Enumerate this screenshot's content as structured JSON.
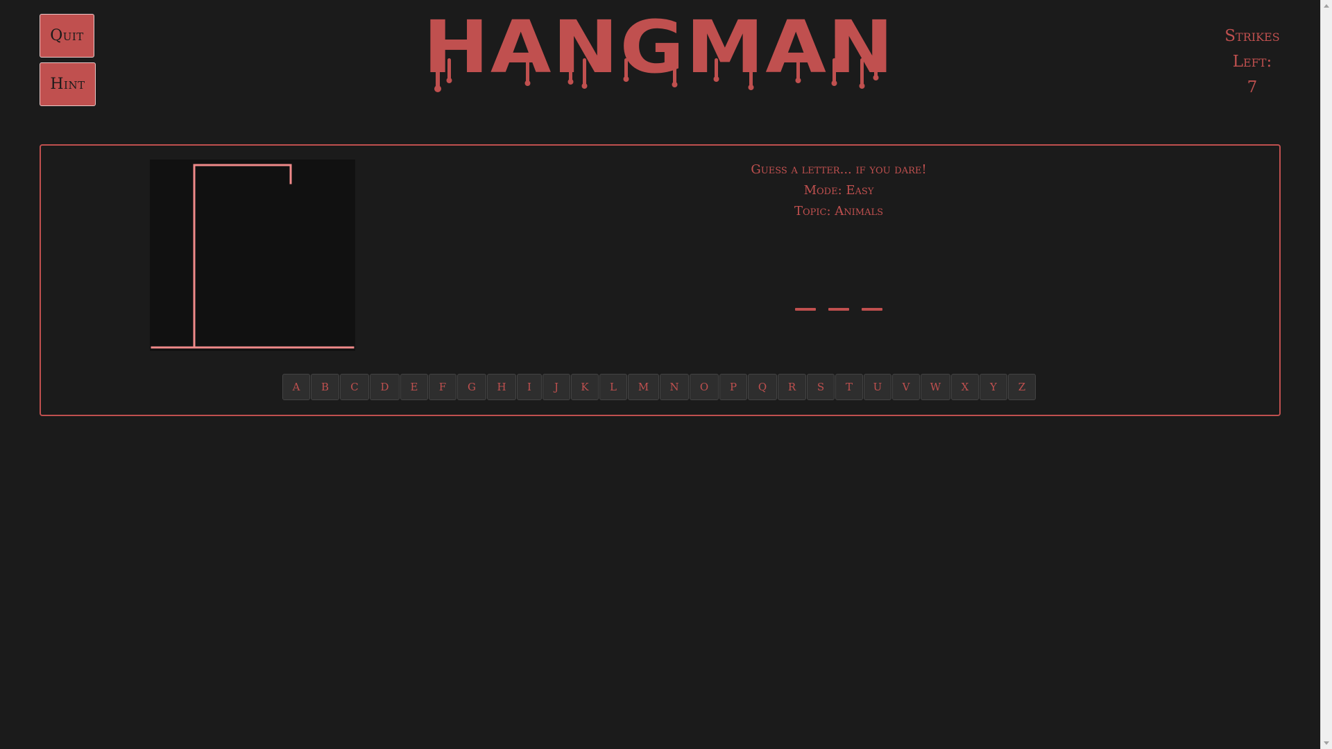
{
  "header": {
    "title": "HANGMAN",
    "quit_label": "Quit",
    "hint_label": "Hint",
    "strikes_label_line1": "Strikes",
    "strikes_label_line2": "Left:",
    "strikes_left": "7"
  },
  "game": {
    "prompt": "Guess a letter... if you dare!",
    "mode_text": "Mode: Easy",
    "topic_text": "Topic: Animals",
    "word_blanks": [
      "",
      "",
      ""
    ],
    "letters": [
      "A",
      "B",
      "C",
      "D",
      "E",
      "F",
      "G",
      "H",
      "I",
      "J",
      "K",
      "L",
      "M",
      "N",
      "O",
      "P",
      "Q",
      "R",
      "S",
      "T",
      "U",
      "V",
      "W",
      "X",
      "Y",
      "Z"
    ]
  },
  "colors": {
    "background": "#1b1b1b",
    "accent": "#c0504f",
    "gallows_line": "#f08a8a",
    "canvas_bg": "#111111",
    "key_bg": "#2e2e2e"
  }
}
